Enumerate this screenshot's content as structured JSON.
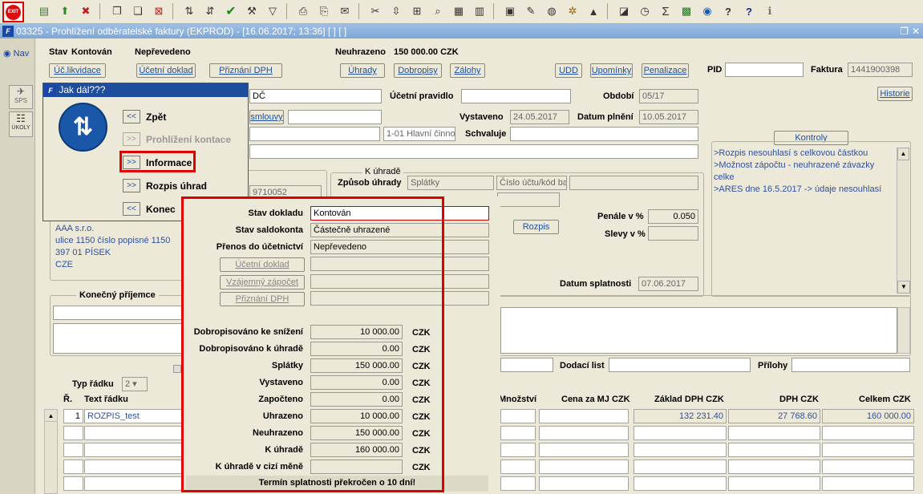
{
  "toolbar": {
    "exit_label": "EXIT"
  },
  "window": {
    "title": "03325 - Prohlížení odběratelské faktury (EKPROD) - [16.06.2017; 13:36] [ ] [ ]"
  },
  "nav": {
    "label": "Nav",
    "sps": "SPS",
    "ukoly": "ÚKOLY"
  },
  "header": {
    "stav_label": "Stav",
    "stav_value": "Kontován",
    "prevod_value": "Nepřevedeno",
    "neuhrazeno_label": "Neuhrazeno",
    "neuhrazeno_value": "150 000.00 CZK",
    "pid_label": "PID",
    "faktura_label": "Faktura",
    "faktura_value": "1441900398"
  },
  "buttons": {
    "uc_likvidace": "Úč.likvidace",
    "ucetni_doklad": "Účetní doklad",
    "priznani_dph": "Přiznání DPH",
    "uhrady": "Úhrady",
    "dobropisy": "Dobropisy",
    "zalohy": "Zálohy",
    "udd": "UDD",
    "upominky": "Upomínky",
    "penalizace": "Penalizace",
    "historie": "Historie",
    "kontroly": "Kontroly",
    "rozpis": "Rozpis"
  },
  "form": {
    "dc_value": "DČ",
    "ucetni_pravidlo_label": "Účetní pravidlo",
    "obdobi_label": "Období",
    "obdobi_value": "05/17",
    "smlouvy_value": "smlouvy",
    "vystaveno_label": "Vystaveno",
    "vystaveno_value": "24.05.2017",
    "datum_plneni_label": "Datum plnění",
    "datum_plneni_value": "10.05.2017",
    "hlavni_cinnost": "1-01 Hlavní činnos",
    "schvaluje_label": "Schvaluje",
    "k_uhrade_group": "K úhradě",
    "zpusob_uhrady_label": "Způsob úhrady",
    "zpusob_uhrady_value": "Splátky",
    "cislo_uctu_value": "Číslo účtu/kód bar",
    "ico_value": "9710052",
    "penale_label": "Penále v %",
    "penale_value": "0.050",
    "slevy_label": "Slevy v %",
    "datum_splatnosti_label": "Datum splatnosti",
    "datum_splatnosti_value": "07.06.2017",
    "address": [
      "AAA s.r.o.",
      "ulice 1150 číslo popisné 1150",
      "397 01 PÍSEK",
      "CZE"
    ],
    "konecny_prijemce": "Konečný příjemce",
    "dodaci_list_label": "Dodací list",
    "prilohy_label": "Přílohy"
  },
  "kontroly_messages": [
    ">Rozpis nesouhlasí s celkovou částkou",
    ">Možnost zápočtu - neuhrazené závazky celke",
    ">ARES dne 16.5.2017 -> údaje nesouhlasí"
  ],
  "dialog": {
    "title": "Jak dál???",
    "items": [
      {
        "btn": "<<",
        "label": "Zpět"
      },
      {
        "btn": ">>",
        "label": "Prohlížení kontace"
      },
      {
        "btn": ">>",
        "label": "Informace"
      },
      {
        "btn": ">>",
        "label": "Rozpis úhrad"
      },
      {
        "btn": "<<",
        "label": "Konec"
      }
    ]
  },
  "info": {
    "stav_dokladu_label": "Stav dokladu",
    "stav_dokladu_value": "Kontován",
    "stav_saldokonta_label": "Stav saldokonta",
    "stav_saldokonta_value": "Částečně uhrazené",
    "prenos_label": "Přenos do účetnictví",
    "prenos_value": "Nepřevedeno",
    "btn_ucetni_doklad": "Účetní doklad",
    "btn_vzajemny_zapocet": "Vzájemný zápočet",
    "btn_priznani_dph": "Přiznání DPH",
    "currency": "CZK",
    "amounts": [
      {
        "label": "Dobropisováno ke snížení",
        "value": "10 000.00"
      },
      {
        "label": "Dobropisováno k úhradě",
        "value": "0.00"
      },
      {
        "label": "Splátky",
        "value": "150 000.00"
      },
      {
        "label": "Vystaveno",
        "value": "0.00"
      },
      {
        "label": "Započteno",
        "value": "0.00"
      },
      {
        "label": "Uhrazeno",
        "value": "10 000.00"
      },
      {
        "label": "Neuhrazeno",
        "value": "150 000.00"
      },
      {
        "label": "K úhradě",
        "value": "160 000.00"
      },
      {
        "label": "K úhradě v cizí měně",
        "value": ""
      }
    ],
    "warning": "Termín splatnosti překročen o 10 dní!"
  },
  "grid": {
    "typ_radku_label": "Typ řádku",
    "typ_radku_value": "2",
    "col_r": "Ř.",
    "col_text": "Text řádku",
    "col_mnozstvi": "Množství",
    "col_cena": "Cena za MJ CZK",
    "col_zaklad": "Základ DPH CZK",
    "col_dph": "DPH CZK",
    "col_celkem": "Celkem CZK",
    "row1": {
      "r": "1",
      "text": "ROZPIS_test",
      "zaklad": "132 231.40",
      "dph": "27 768.60",
      "celkem": "160 000.00"
    }
  }
}
